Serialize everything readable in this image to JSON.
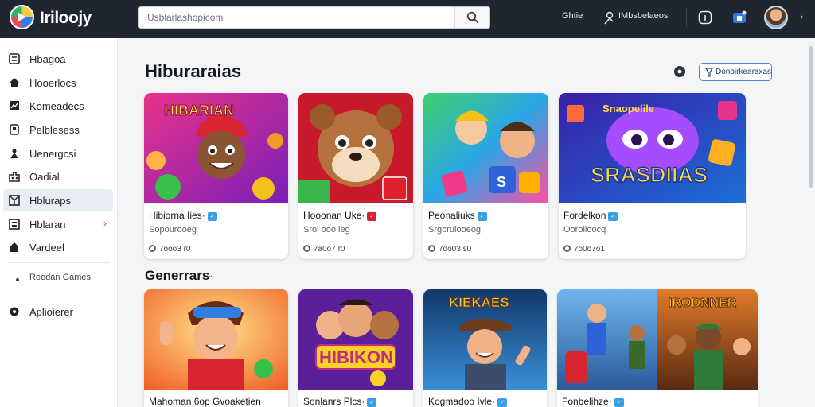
{
  "app": {
    "name": "Iriloojy",
    "logo_icon": "play-logo-icon"
  },
  "search": {
    "placeholder": "Usblarlashopicom",
    "value": ""
  },
  "topbar": {
    "link1": "Ghtie",
    "link2": "IMbsbelaeos",
    "icons": [
      "user-icon",
      "info-icon",
      "notification-icon",
      "avatar",
      "chevron-down-icon"
    ]
  },
  "sidebar": {
    "items": [
      {
        "label": "Hbagoa",
        "icon": "library-icon"
      },
      {
        "label": "Hooerlocs",
        "icon": "home-icon"
      },
      {
        "label": "Komeadecs",
        "icon": "chart-icon"
      },
      {
        "label": "Pelblesess",
        "icon": "bookmark-icon"
      },
      {
        "label": "Uenergcsi",
        "icon": "person-icon"
      },
      {
        "label": "Oadial",
        "icon": "controller-icon"
      },
      {
        "label": "Hbluraps",
        "icon": "grid-icon",
        "active": true
      },
      {
        "label": "Hblaran",
        "icon": "list-icon",
        "arrow": "›"
      },
      {
        "label": "Vardeel",
        "icon": "upload-icon"
      }
    ],
    "sub_item": "Reedan Games",
    "last_item": {
      "label": "Aplioierer",
      "icon": "gear-icon"
    }
  },
  "main": {
    "heading": "Hiburaraias",
    "filter_label": "Donoirkearaxas",
    "section2": "Generrars",
    "section2_icon": "⌄"
  },
  "cards_row1": [
    {
      "title": "Hibiorna Iies·",
      "sub": "Sopourooeg",
      "stat": "7ooo3 r0",
      "thumb_text": "HIBARIAN"
    },
    {
      "title": "Hooonan Uke·",
      "sub": "Srol ooo ieg",
      "stat": "7a0o7 r0",
      "thumb_text": ""
    },
    {
      "title": "Peonaliuks",
      "sub": "Srgbrulooeog",
      "stat": "7do03 s0",
      "thumb_text": "S"
    },
    {
      "title": "Fordelkon",
      "sub": "Ooroiioocq",
      "stat": "7o0o7o1",
      "thumb_text": "SRASDIIAS"
    }
  ],
  "cards_row2": [
    {
      "title": "Mahoman 6op Gvoaketien",
      "thumb_text": ""
    },
    {
      "title": "Sonlanrs Plcs·",
      "thumb_text": "HIBIKON"
    },
    {
      "title": "Kogmadoo Ivle·",
      "thumb_text": "KIEKAES"
    },
    {
      "title": "Fonbelihze·",
      "thumb_text": "IRODNNER"
    }
  ],
  "colors": {
    "topbar": "#1f262f",
    "accent": "#3aa0e6",
    "active": "#e8edf3"
  }
}
